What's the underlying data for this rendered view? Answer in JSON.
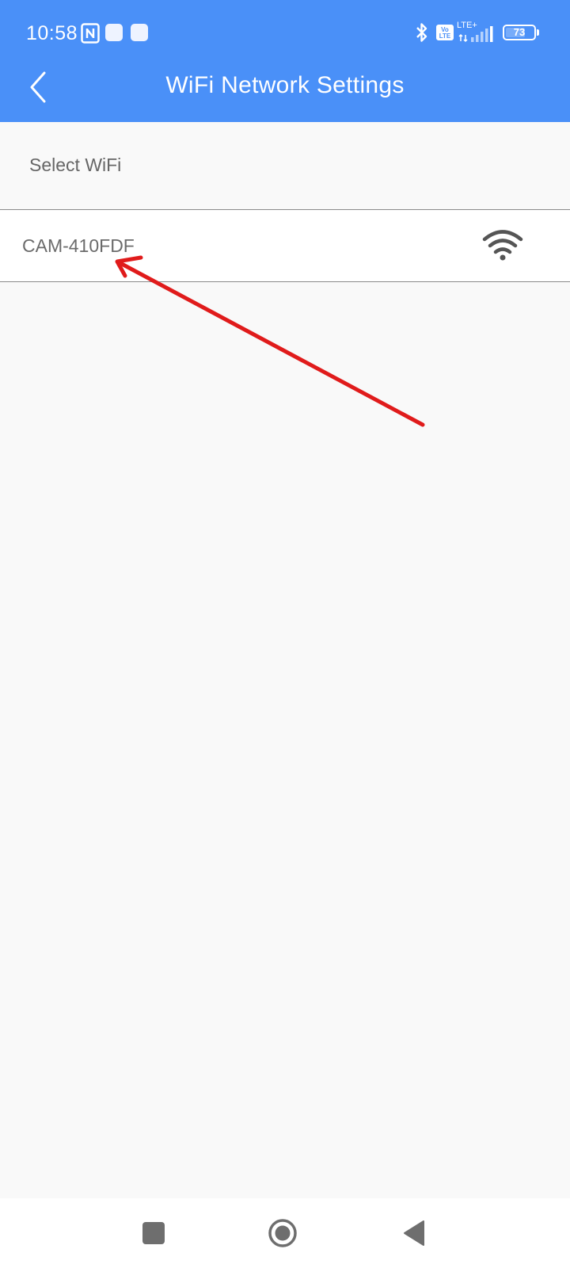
{
  "status_bar": {
    "time": "10:58",
    "network_type": "LTE+",
    "volte_top": "Vo",
    "volte_bottom": "LTE",
    "battery_percent": "73",
    "battery_level": 0.73
  },
  "header": {
    "title": "WiFi Network Settings",
    "background_color": "#4a90f8"
  },
  "section": {
    "label": "Select WiFi"
  },
  "networks": [
    {
      "ssid": "CAM-410FDF",
      "signal_icon": "wifi-strong-icon"
    }
  ],
  "annotation": {
    "color": "#e01b1b",
    "icon": "red-arrow-pointer"
  },
  "nav_bar": {
    "recent_icon": "square-icon",
    "home_icon": "circle-icon",
    "back_icon": "triangle-back-icon"
  }
}
